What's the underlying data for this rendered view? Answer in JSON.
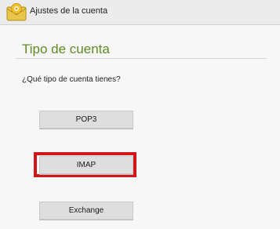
{
  "window": {
    "title": "Ajustes de la cuenta",
    "app_icon": "email-settings-icon"
  },
  "page": {
    "title": "Tipo de cuenta",
    "question": "¿Qué tipo de cuenta tienes?"
  },
  "options": [
    {
      "label": "POP3",
      "highlighted": false
    },
    {
      "label": "IMAP",
      "highlighted": true
    },
    {
      "label": "Exchange",
      "highlighted": false
    }
  ],
  "colors": {
    "title_green": "#5e8a24",
    "highlight_red": "#d0161b",
    "icon_yellow": "#f2c230"
  }
}
